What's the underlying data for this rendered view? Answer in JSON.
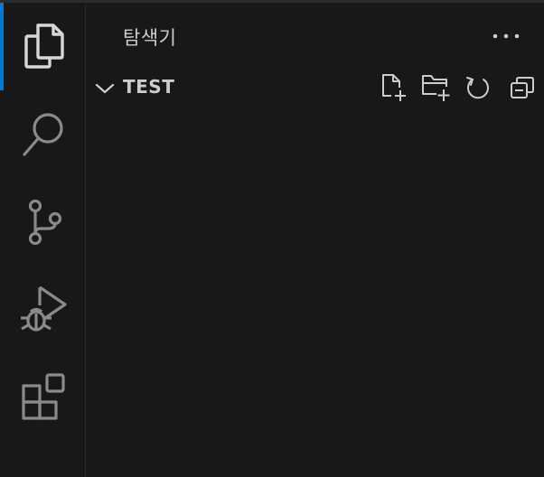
{
  "activity_bar": {
    "items": [
      {
        "icon": "explorer-files-icon",
        "active": true
      },
      {
        "icon": "search-icon",
        "active": false
      },
      {
        "icon": "source-control-icon",
        "active": false
      },
      {
        "icon": "run-debug-icon",
        "active": false
      },
      {
        "icon": "extensions-icon",
        "active": false
      }
    ],
    "accent_color": "#0078d4"
  },
  "sidebar": {
    "title": "탐색기",
    "more_icon": "ellipsis-icon",
    "section": {
      "title": "TEST",
      "expanded": true,
      "actions": [
        {
          "icon": "new-file-icon"
        },
        {
          "icon": "new-folder-icon"
        },
        {
          "icon": "refresh-icon"
        },
        {
          "icon": "collapse-all-icon"
        }
      ]
    }
  },
  "colors": {
    "background": "#181818",
    "foreground": "#cccccc",
    "border": "#2b2b2b"
  }
}
